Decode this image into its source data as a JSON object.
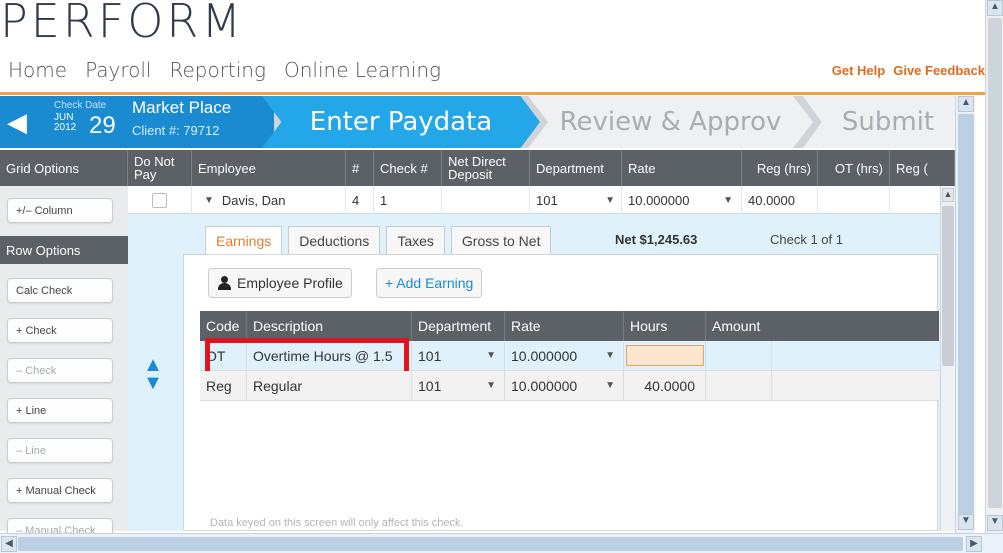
{
  "logo": {
    "text": "PERFORM"
  },
  "nav": {
    "items": [
      "Home",
      "Payroll",
      "Reporting",
      "Online Learning"
    ],
    "get_help": "Get Help",
    "give_feedback": "Give Feedback"
  },
  "wizard": {
    "check_date_label": "Check Date",
    "month": "JUN",
    "year": "2012",
    "day": "29",
    "company": "Market Place",
    "client": "Client #: 79712",
    "steps": [
      "Enter Paydata",
      "Review & Approv",
      "Submit"
    ]
  },
  "grid": {
    "columns": [
      "Grid Options",
      "Do Not Pay",
      "Employee",
      "#",
      "Check #",
      "Net Direct Deposit",
      "Department",
      "Rate",
      "Reg (hrs)",
      "OT (hrs)",
      "Reg ("
    ],
    "row": {
      "employee": "Davis, Dan",
      "number": "4",
      "check_number": "1",
      "department": "101",
      "rate": "10.000000",
      "reg_hrs": "40.0000"
    }
  },
  "sidebar": {
    "column_button": "+/– Column",
    "row_options": "Row Options",
    "buttons": [
      "Calc Check",
      "+ Check",
      "– Check",
      "+ Line",
      "– Line",
      "+ Manual Check",
      "– Manual Check"
    ]
  },
  "tabs": {
    "items": [
      "Earnings",
      "Deductions",
      "Taxes",
      "Gross to Net"
    ],
    "net": "Net $1,245.63",
    "check_of": "Check 1 of 1"
  },
  "panel": {
    "employee_profile": "Employee Profile",
    "add_earning": "+ Add Earning",
    "columns": [
      "Code",
      "Description",
      "Department",
      "Rate",
      "Hours",
      "Amount"
    ],
    "rows": [
      {
        "code": "OT",
        "description": "Overtime Hours @ 1.5",
        "department": "101",
        "rate": "10.000000",
        "hours": "",
        "amount": ""
      },
      {
        "code": "Reg",
        "description": "Regular",
        "department": "101",
        "rate": "10.000000",
        "hours": "40.0000",
        "amount": ""
      }
    ],
    "footnote": "Data keyed on this screen will only affect this check."
  },
  "colors": {
    "accent": "#24a7e8",
    "orange": "#e06b1e",
    "highlight": "#e0141d",
    "header": "#5c6167"
  },
  "icons": [
    "back-arrow-icon",
    "person-icon",
    "up-arrow-icon",
    "down-arrow-icon",
    "dropdown-caret-icon"
  ]
}
